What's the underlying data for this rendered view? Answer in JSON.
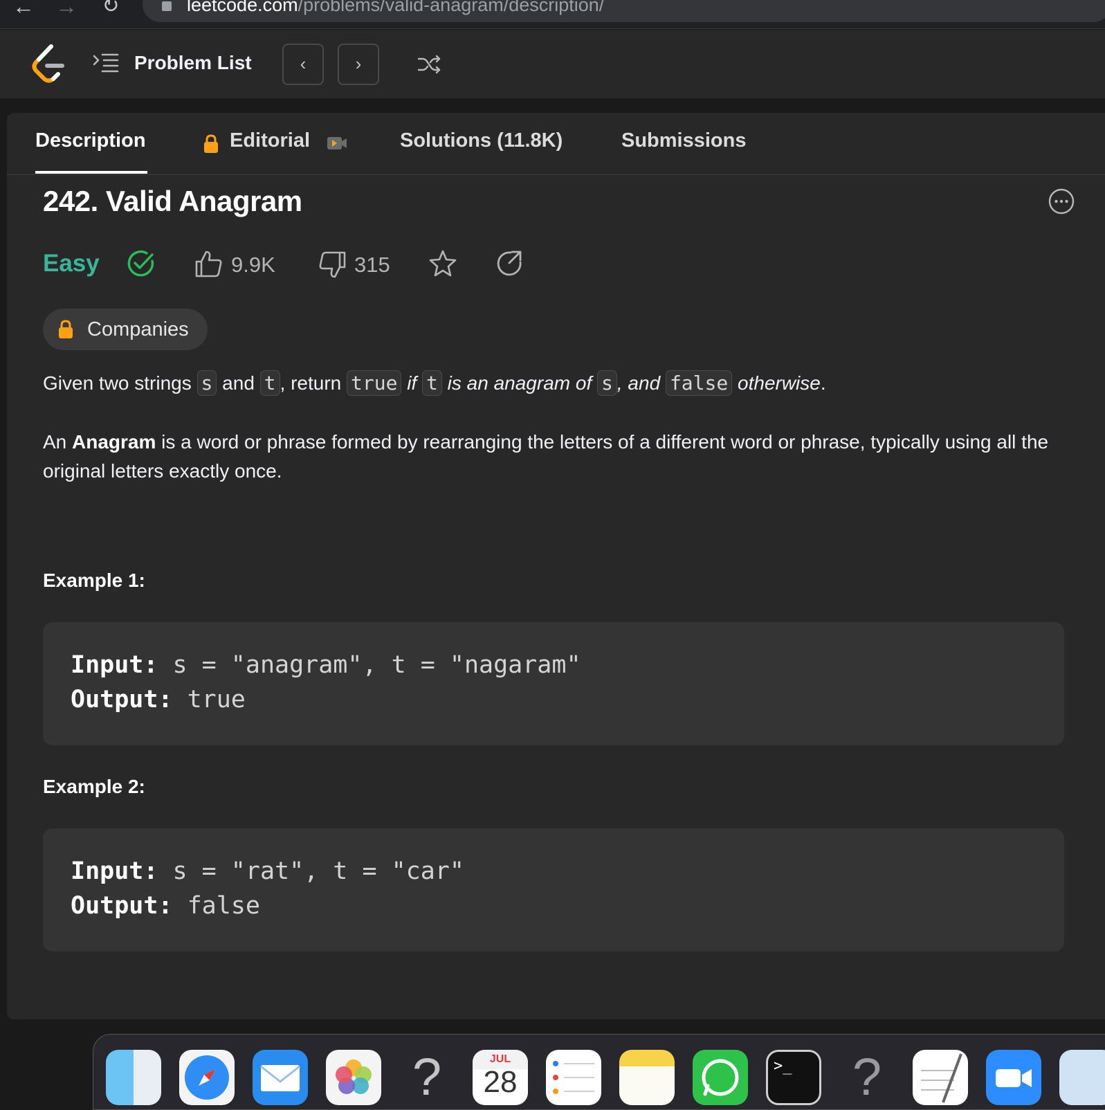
{
  "browser": {
    "url_host": "leetcode.com",
    "url_path": "/problems/valid-anagram/description/"
  },
  "navbar": {
    "problem_list_label": "Problem List"
  },
  "tabs": [
    {
      "label": "Description",
      "active": true
    },
    {
      "label": "Editorial",
      "locked": true
    },
    {
      "label": "Solutions (11.8K)"
    },
    {
      "label": "Submissions"
    }
  ],
  "problem": {
    "title": "242. Valid Anagram",
    "difficulty": "Easy",
    "likes": "9.9K",
    "dislikes": "315",
    "companies_label": "Companies"
  },
  "description": {
    "p1": {
      "t1": "Given two strings ",
      "c1": "s",
      "t2": " and ",
      "c2": "t",
      "t3": ", return ",
      "c3": "true",
      "t4": " ",
      "e1": "if",
      "t5": " ",
      "c4": "t",
      "t6": " ",
      "e2": "is an anagram of",
      "t7": " ",
      "c5": "s",
      "e3": ", and",
      "t8": " ",
      "c6": "false",
      "t9": " ",
      "e4": "otherwise",
      "t10": "."
    },
    "p2": {
      "t1": "An ",
      "b1": "Anagram",
      "t2": " is a word or phrase formed by rearranging the letters of a different word or phrase, typically using all the original letters exactly once."
    }
  },
  "examples": [
    {
      "heading": "Example 1:",
      "input_key": "Input:",
      "input_val": " s = \"anagram\", t = \"nagaram\"",
      "output_key": "Output:",
      "output_val": " true"
    },
    {
      "heading": "Example 2:",
      "input_key": "Input:",
      "input_val": " s = \"rat\", t = \"car\"",
      "output_key": "Output:",
      "output_val": " false"
    }
  ],
  "dock": {
    "calendar_month": "JUL",
    "calendar_day": "28",
    "apps": [
      "finder-icon",
      "safari-icon",
      "mail-icon",
      "photos-icon",
      "unknown-app-icon",
      "calendar-icon",
      "reminders-icon",
      "notes-icon",
      "whatsapp-icon",
      "terminal-icon",
      "unknown-app-icon",
      "textedit-icon",
      "zoom-icon",
      "preview-icon"
    ]
  },
  "colors": {
    "easy": "#39b69a",
    "accent_orange": "#ffa116",
    "background": "#282828"
  }
}
